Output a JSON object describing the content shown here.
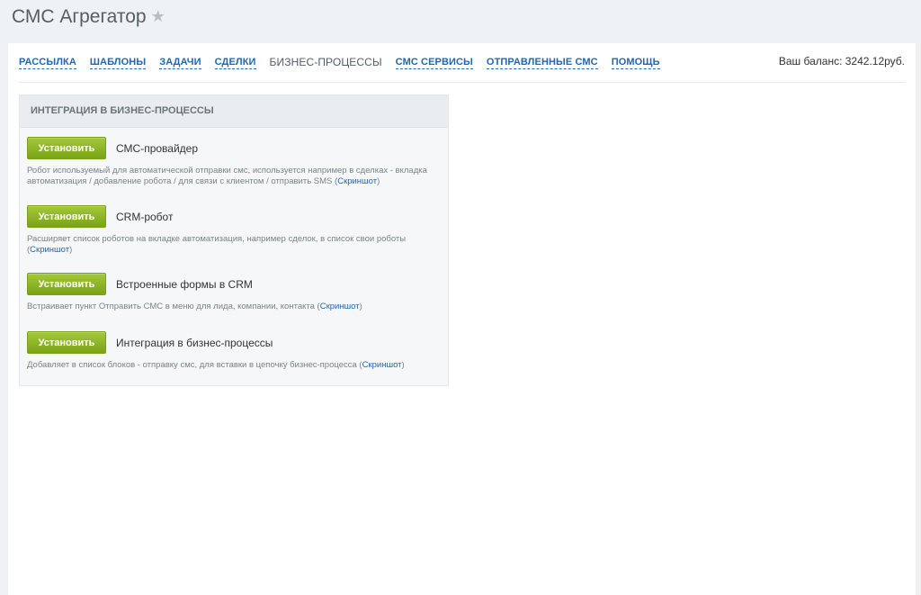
{
  "app": {
    "title": "СМС Агрегатор",
    "star_glyph": "★"
  },
  "nav": {
    "items": [
      {
        "label": "РАССЫЛКА"
      },
      {
        "label": "ШАБЛОНЫ"
      },
      {
        "label": "ЗАДАЧИ"
      },
      {
        "label": "СДЕЛКИ"
      },
      {
        "label": "БИЗНЕС-ПРОЦЕССЫ",
        "active": true
      },
      {
        "label": "СМС СЕРВИСЫ"
      },
      {
        "label": "ОТПРАВЛЕННЫЕ СМС"
      },
      {
        "label": "ПОМОЩЬ"
      }
    ],
    "balance": "Ваш баланс: 3242.12руб."
  },
  "panel": {
    "title": "ИНТЕГРАЦИЯ В БИЗНЕС-ПРОЦЕССЫ",
    "items": [
      {
        "button": "Установить",
        "title": "СМС-провайдер",
        "desc": "Робот используемый для автоматической отправки смс, используется например в сделках - вкладка автоматизация / добавление робота / для связи с клиентом / отправить SMS (",
        "link": "Скриншот",
        "after": ")"
      },
      {
        "button": "Установить",
        "title": "CRM-робот",
        "desc": "Расширяет список роботов на вкладке автоматизация, например сделок, в список свои роботы (",
        "link": "Скриншот",
        "after": ")"
      },
      {
        "button": "Установить",
        "title": "Встроенные формы в CRM",
        "desc": "Встраивает пункт Отправить СМС в меню для лида, компании, контакта (",
        "link": "Скриншот",
        "after": ")"
      },
      {
        "button": "Установить",
        "title": "Интеграция в бизнес-процессы",
        "desc": "Добавляет в список блоков - отправку смс, для вставки в цепочку бизнес-процесса (",
        "link": "Скриншот",
        "after": ")"
      }
    ]
  },
  "colors": {
    "accent_link": "#2067b0",
    "button_green": "#8db828",
    "page_bg": "#eef2f4"
  }
}
